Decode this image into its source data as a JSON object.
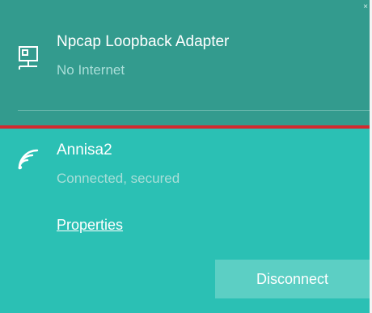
{
  "networks": [
    {
      "name": "Npcap Loopback Adapter",
      "status": "No Internet",
      "icon": "wired-network-icon"
    },
    {
      "name": "Annisa2",
      "status": "Connected, secured",
      "icon": "wifi-signal-icon",
      "properties_label": "Properties",
      "disconnect_label": "Disconnect"
    }
  ],
  "close_glyph": "×",
  "colors": {
    "upper_bg": "#339b8e",
    "lower_bg": "#2bc0b4",
    "divider": "#d22a2f",
    "button_bg": "#5ccfc4"
  }
}
